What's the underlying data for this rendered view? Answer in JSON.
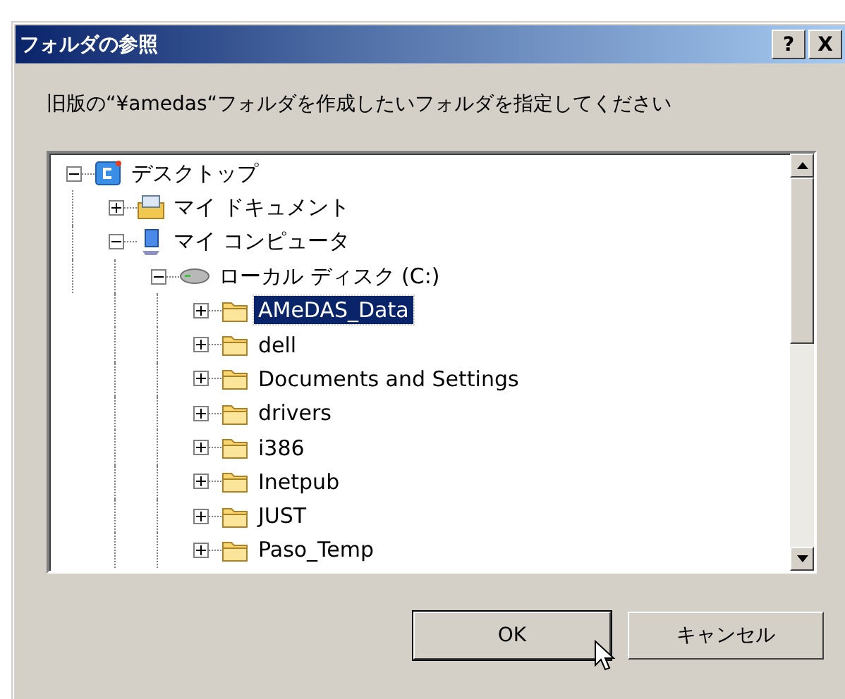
{
  "window": {
    "title": "フォルダの参照",
    "help_button": "?",
    "close_button": "X"
  },
  "prompt": "旧版の“¥amedas“フォルダを作成したいフォルダを指定してください",
  "tree": [
    {
      "label": "デスクトップ",
      "kind": "desktop",
      "expanded": true,
      "selected": false,
      "children": [
        {
          "label": "マイ ドキュメント",
          "kind": "documents",
          "expanded": false,
          "selected": false
        },
        {
          "label": "マイ コンピュータ",
          "kind": "computer",
          "expanded": true,
          "selected": false,
          "children": [
            {
              "label": "ローカル ディスク (C:)",
              "kind": "drive",
              "expanded": true,
              "selected": false,
              "children": [
                {
                  "label": "AMeDAS_Data",
                  "kind": "folder",
                  "expanded": false,
                  "selected": true
                },
                {
                  "label": "dell",
                  "kind": "folder",
                  "expanded": false,
                  "selected": false
                },
                {
                  "label": "Documents and Settings",
                  "kind": "folder",
                  "expanded": false,
                  "selected": false
                },
                {
                  "label": "drivers",
                  "kind": "folder",
                  "expanded": false,
                  "selected": false
                },
                {
                  "label": "i386",
                  "kind": "folder",
                  "expanded": false,
                  "selected": false
                },
                {
                  "label": "Inetpub",
                  "kind": "folder",
                  "expanded": false,
                  "selected": false
                },
                {
                  "label": "JUST",
                  "kind": "folder",
                  "expanded": false,
                  "selected": false
                },
                {
                  "label": "Paso_Temp",
                  "kind": "folder",
                  "expanded": false,
                  "selected": false
                }
              ]
            }
          ]
        }
      ]
    }
  ],
  "buttons": [
    {
      "label": "OK",
      "default": true
    },
    {
      "label": "キャンセル",
      "default": false
    }
  ]
}
